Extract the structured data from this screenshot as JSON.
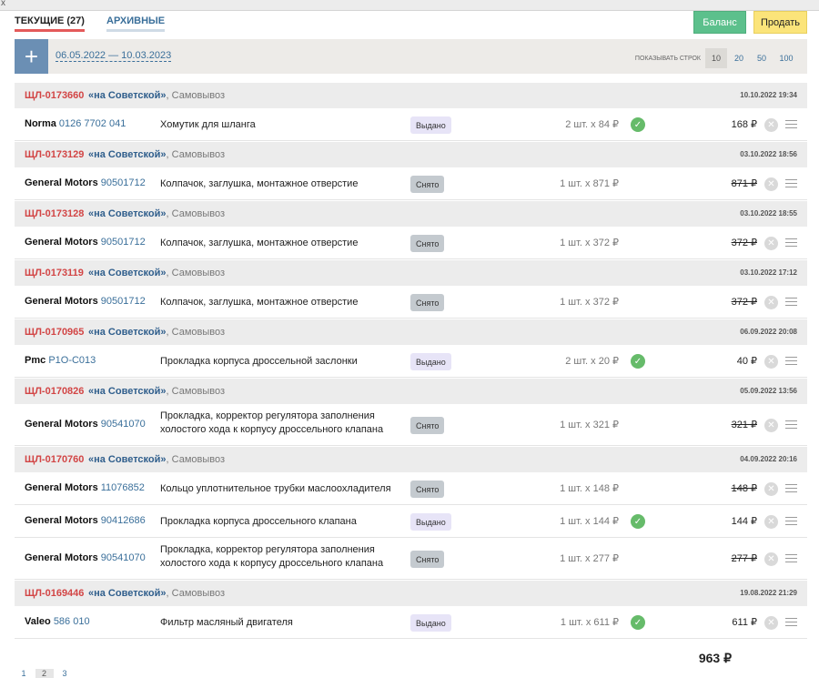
{
  "window": {
    "close_glyph": "x"
  },
  "tabs": [
    {
      "label": "ТЕКУЩИЕ (27)"
    },
    {
      "label": "АРХИВНЫЕ"
    }
  ],
  "actions": {
    "balance_label": "Баланс",
    "sell_label": "Продать"
  },
  "filter": {
    "add_glyph": "+",
    "date_range": "06.05.2022 — 10.03.2023",
    "show_rows_label": "ПОКАЗЫВАТЬ СТРОК",
    "row_options": [
      "10",
      "20",
      "50",
      "100"
    ],
    "selected_rows": "10"
  },
  "orders": [
    {
      "number": "ЩЛ-0173660",
      "shop": "«на Советской»",
      "delivery": ", Самовывоз",
      "date": "10.10.2022 19:34",
      "items": [
        {
          "brand": "Norma",
          "code": "0126 7702 041",
          "name": "Хомутик для шланга",
          "status": "Выдано",
          "qty": "2 шт. x 84 ₽",
          "price": "168 ₽"
        }
      ]
    },
    {
      "number": "ЩЛ-0173129",
      "shop": "«на Советской»",
      "delivery": ", Самовывоз",
      "date": "03.10.2022 18:56",
      "items": [
        {
          "brand": "General Motors",
          "code": "90501712",
          "name": "Колпачок, заглушка, монтажное отверстие",
          "status": "Снято",
          "qty": "1 шт. x 871 ₽",
          "price": "871 ₽"
        }
      ]
    },
    {
      "number": "ЩЛ-0173128",
      "shop": "«на Советской»",
      "delivery": ", Самовывоз",
      "date": "03.10.2022 18:55",
      "items": [
        {
          "brand": "General Motors",
          "code": "90501712",
          "name": "Колпачок, заглушка, монтажное отверстие",
          "status": "Снято",
          "qty": "1 шт. x 372 ₽",
          "price": "372 ₽"
        }
      ]
    },
    {
      "number": "ЩЛ-0173119",
      "shop": "«на Советской»",
      "delivery": ", Самовывоз",
      "date": "03.10.2022 17:12",
      "items": [
        {
          "brand": "General Motors",
          "code": "90501712",
          "name": "Колпачок, заглушка, монтажное отверстие",
          "status": "Снято",
          "qty": "1 шт. x 372 ₽",
          "price": "372 ₽"
        }
      ]
    },
    {
      "number": "ЩЛ-0170965",
      "shop": "«на Советской»",
      "delivery": ", Самовывоз",
      "date": "06.09.2022 20:08",
      "items": [
        {
          "brand": "Pmc",
          "code": "P1O-C013",
          "name": "Прокладка корпуса дроссельной заслонки",
          "status": "Выдано",
          "qty": "2 шт. x 20 ₽",
          "price": "40 ₽"
        }
      ]
    },
    {
      "number": "ЩЛ-0170826",
      "shop": "«на Советской»",
      "delivery": ", Самовывоз",
      "date": "05.09.2022 13:56",
      "items": [
        {
          "brand": "General Motors",
          "code": "90541070",
          "name": "Прокладка, корректор регулятора заполнения холостого хода к корпусу дроссельного клапана",
          "status": "Снято",
          "qty": "1 шт. x 321 ₽",
          "price": "321 ₽"
        }
      ]
    },
    {
      "number": "ЩЛ-0170760",
      "shop": "«на Советской»",
      "delivery": ", Самовывоз",
      "date": "04.09.2022 20:16",
      "items": [
        {
          "brand": "General Motors",
          "code": "11076852",
          "name": "Кольцо уплотнительное трубки маслоохладителя",
          "status": "Снято",
          "qty": "1 шт. x 148 ₽",
          "price": "148 ₽"
        },
        {
          "brand": "General Motors",
          "code": "90412686",
          "name": "Прокладка корпуса дроссельного клапана",
          "status": "Выдано",
          "qty": "1 шт. x 144 ₽",
          "price": "144 ₽"
        },
        {
          "brand": "General Motors",
          "code": "90541070",
          "name": "Прокладка, корректор регулятора заполнения холостого хода к корпусу дроссельного клапана",
          "status": "Снято",
          "qty": "1 шт. x 277 ₽",
          "price": "277 ₽"
        }
      ]
    },
    {
      "number": "ЩЛ-0169446",
      "shop": "«на Советской»",
      "delivery": ", Самовывоз",
      "date": "19.08.2022 21:29",
      "items": [
        {
          "brand": "Valeo",
          "code": "586 010",
          "name": "Фильтр масляный двигателя",
          "status": "Выдано",
          "qty": "1 шт. x 611 ₽",
          "price": "611 ₽"
        }
      ]
    }
  ],
  "icons": {
    "check": "check-icon",
    "remove": "close-icon",
    "menu": "menu-icon"
  },
  "glyphs": {
    "check": "✓",
    "remove": "✕"
  },
  "total": "963 ₽",
  "pager": {
    "pages": [
      "1",
      "2",
      "3"
    ],
    "current": "2"
  },
  "colors": {
    "order_number": "#d24545",
    "shop": "#2f5e8c",
    "issued_badge": "#e7e4f7",
    "removed_badge": "#c4cacf",
    "balance": "#5cc08c",
    "sell": "#fbe47a",
    "add": "#6b8fb4",
    "active_tab": "#e45a5a"
  }
}
